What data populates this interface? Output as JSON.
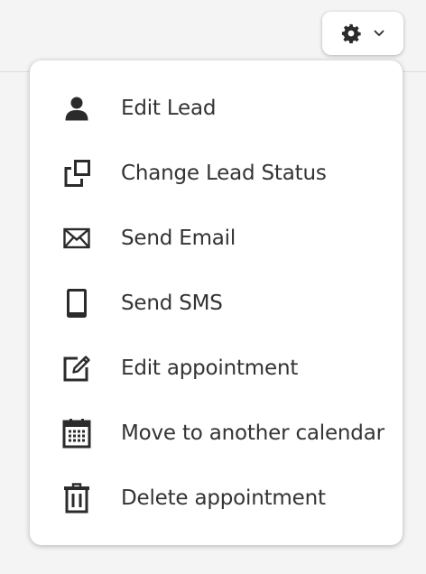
{
  "colors": {
    "text": "#333333",
    "icon": "#2b2b2b",
    "background": "#f4f4f4",
    "menu_background": "#ffffff"
  },
  "toolbar": {
    "settings_icon": "gear-icon",
    "dropdown_icon": "chevron-down-icon"
  },
  "menu": {
    "items": [
      {
        "label": "Edit Lead",
        "icon": "person-icon"
      },
      {
        "label": "Change Lead Status",
        "icon": "status-change-icon"
      },
      {
        "label": "Send Email",
        "icon": "envelope-icon"
      },
      {
        "label": "Send SMS",
        "icon": "phone-icon"
      },
      {
        "label": "Edit appointment",
        "icon": "edit-icon"
      },
      {
        "label": "Move to another calendar",
        "icon": "calendar-icon"
      },
      {
        "label": "Delete appointment",
        "icon": "trash-icon"
      }
    ]
  }
}
